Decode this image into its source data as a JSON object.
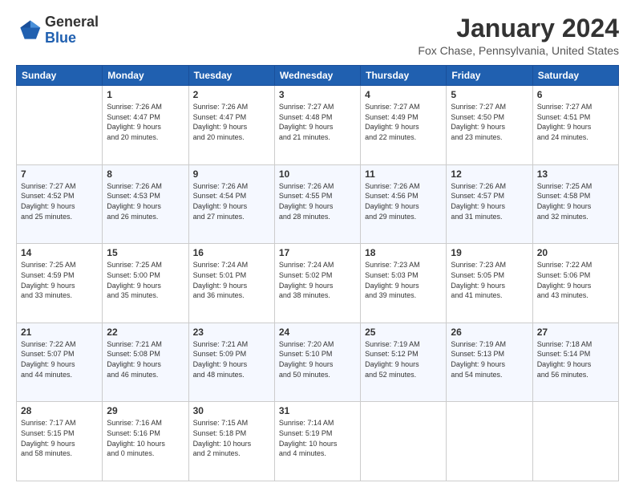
{
  "logo": {
    "text_general": "General",
    "text_blue": "Blue"
  },
  "header": {
    "month": "January 2024",
    "location": "Fox Chase, Pennsylvania, United States"
  },
  "weekdays": [
    "Sunday",
    "Monday",
    "Tuesday",
    "Wednesday",
    "Thursday",
    "Friday",
    "Saturday"
  ],
  "weeks": [
    [
      {
        "day": "",
        "info": ""
      },
      {
        "day": "1",
        "info": "Sunrise: 7:26 AM\nSunset: 4:47 PM\nDaylight: 9 hours\nand 20 minutes."
      },
      {
        "day": "2",
        "info": "Sunrise: 7:26 AM\nSunset: 4:47 PM\nDaylight: 9 hours\nand 20 minutes."
      },
      {
        "day": "3",
        "info": "Sunrise: 7:27 AM\nSunset: 4:48 PM\nDaylight: 9 hours\nand 21 minutes."
      },
      {
        "day": "4",
        "info": "Sunrise: 7:27 AM\nSunset: 4:49 PM\nDaylight: 9 hours\nand 22 minutes."
      },
      {
        "day": "5",
        "info": "Sunrise: 7:27 AM\nSunset: 4:50 PM\nDaylight: 9 hours\nand 23 minutes."
      },
      {
        "day": "6",
        "info": "Sunrise: 7:27 AM\nSunset: 4:51 PM\nDaylight: 9 hours\nand 24 minutes."
      }
    ],
    [
      {
        "day": "7",
        "info": "Sunrise: 7:27 AM\nSunset: 4:52 PM\nDaylight: 9 hours\nand 25 minutes."
      },
      {
        "day": "8",
        "info": "Sunrise: 7:26 AM\nSunset: 4:53 PM\nDaylight: 9 hours\nand 26 minutes."
      },
      {
        "day": "9",
        "info": "Sunrise: 7:26 AM\nSunset: 4:54 PM\nDaylight: 9 hours\nand 27 minutes."
      },
      {
        "day": "10",
        "info": "Sunrise: 7:26 AM\nSunset: 4:55 PM\nDaylight: 9 hours\nand 28 minutes."
      },
      {
        "day": "11",
        "info": "Sunrise: 7:26 AM\nSunset: 4:56 PM\nDaylight: 9 hours\nand 29 minutes."
      },
      {
        "day": "12",
        "info": "Sunrise: 7:26 AM\nSunset: 4:57 PM\nDaylight: 9 hours\nand 31 minutes."
      },
      {
        "day": "13",
        "info": "Sunrise: 7:25 AM\nSunset: 4:58 PM\nDaylight: 9 hours\nand 32 minutes."
      }
    ],
    [
      {
        "day": "14",
        "info": "Sunrise: 7:25 AM\nSunset: 4:59 PM\nDaylight: 9 hours\nand 33 minutes."
      },
      {
        "day": "15",
        "info": "Sunrise: 7:25 AM\nSunset: 5:00 PM\nDaylight: 9 hours\nand 35 minutes."
      },
      {
        "day": "16",
        "info": "Sunrise: 7:24 AM\nSunset: 5:01 PM\nDaylight: 9 hours\nand 36 minutes."
      },
      {
        "day": "17",
        "info": "Sunrise: 7:24 AM\nSunset: 5:02 PM\nDaylight: 9 hours\nand 38 minutes."
      },
      {
        "day": "18",
        "info": "Sunrise: 7:23 AM\nSunset: 5:03 PM\nDaylight: 9 hours\nand 39 minutes."
      },
      {
        "day": "19",
        "info": "Sunrise: 7:23 AM\nSunset: 5:05 PM\nDaylight: 9 hours\nand 41 minutes."
      },
      {
        "day": "20",
        "info": "Sunrise: 7:22 AM\nSunset: 5:06 PM\nDaylight: 9 hours\nand 43 minutes."
      }
    ],
    [
      {
        "day": "21",
        "info": "Sunrise: 7:22 AM\nSunset: 5:07 PM\nDaylight: 9 hours\nand 44 minutes."
      },
      {
        "day": "22",
        "info": "Sunrise: 7:21 AM\nSunset: 5:08 PM\nDaylight: 9 hours\nand 46 minutes."
      },
      {
        "day": "23",
        "info": "Sunrise: 7:21 AM\nSunset: 5:09 PM\nDaylight: 9 hours\nand 48 minutes."
      },
      {
        "day": "24",
        "info": "Sunrise: 7:20 AM\nSunset: 5:10 PM\nDaylight: 9 hours\nand 50 minutes."
      },
      {
        "day": "25",
        "info": "Sunrise: 7:19 AM\nSunset: 5:12 PM\nDaylight: 9 hours\nand 52 minutes."
      },
      {
        "day": "26",
        "info": "Sunrise: 7:19 AM\nSunset: 5:13 PM\nDaylight: 9 hours\nand 54 minutes."
      },
      {
        "day": "27",
        "info": "Sunrise: 7:18 AM\nSunset: 5:14 PM\nDaylight: 9 hours\nand 56 minutes."
      }
    ],
    [
      {
        "day": "28",
        "info": "Sunrise: 7:17 AM\nSunset: 5:15 PM\nDaylight: 9 hours\nand 58 minutes."
      },
      {
        "day": "29",
        "info": "Sunrise: 7:16 AM\nSunset: 5:16 PM\nDaylight: 10 hours\nand 0 minutes."
      },
      {
        "day": "30",
        "info": "Sunrise: 7:15 AM\nSunset: 5:18 PM\nDaylight: 10 hours\nand 2 minutes."
      },
      {
        "day": "31",
        "info": "Sunrise: 7:14 AM\nSunset: 5:19 PM\nDaylight: 10 hours\nand 4 minutes."
      },
      {
        "day": "",
        "info": ""
      },
      {
        "day": "",
        "info": ""
      },
      {
        "day": "",
        "info": ""
      }
    ]
  ]
}
